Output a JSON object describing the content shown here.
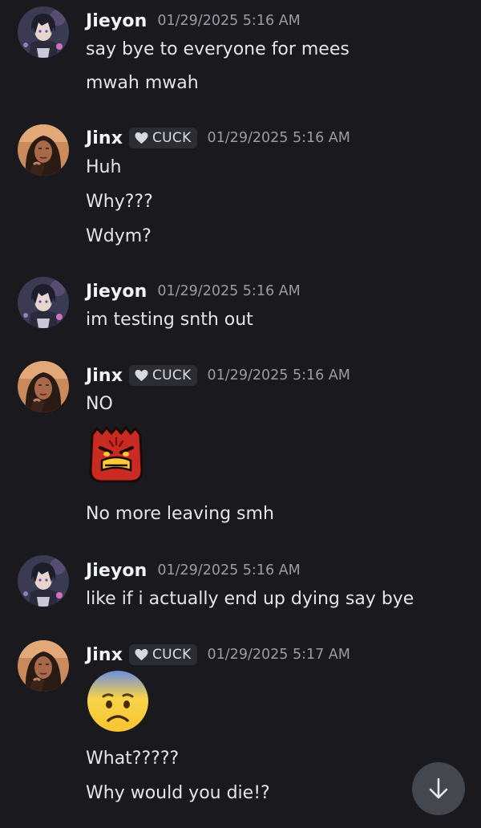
{
  "messages": [
    {
      "author": "Jieyon",
      "avatar_icon": "anime-avatar-icon",
      "timestamp": "01/29/2025 5:16 AM",
      "lines": [
        "say bye to everyone for mees",
        "mwah mwah"
      ]
    },
    {
      "author": "Jinx",
      "avatar_icon": "portrait-avatar-icon",
      "tag": "CUCK",
      "tag_icon": "heart-icon",
      "timestamp": "01/29/2025 5:16 AM",
      "lines": [
        "Huh",
        "Why???",
        "Wdym?"
      ]
    },
    {
      "author": "Jieyon",
      "avatar_icon": "anime-avatar-icon",
      "timestamp": "01/29/2025 5:16 AM",
      "lines": [
        "im testing snth out"
      ]
    },
    {
      "author": "Jinx",
      "avatar_icon": "portrait-avatar-icon",
      "tag": "CUCK",
      "tag_icon": "heart-icon",
      "timestamp": "01/29/2025 5:16 AM",
      "lines": [
        "NO",
        "No more leaving smh"
      ],
      "emoji": "angry-red-bag-emoji"
    },
    {
      "author": "Jieyon",
      "avatar_icon": "anime-avatar-icon",
      "timestamp": "01/29/2025 5:16 AM",
      "lines": [
        "like if i actually end up dying  say bye"
      ]
    },
    {
      "author": "Jinx",
      "avatar_icon": "portrait-avatar-icon",
      "tag": "CUCK",
      "tag_icon": "heart-icon",
      "timestamp": "01/29/2025 5:17 AM",
      "lines": [
        "What?????",
        "Why would you die!?"
      ],
      "emoji": "anxious-face-emoji"
    }
  ],
  "scroll_button_icon": "arrow-down-icon",
  "colors": {
    "background": "#1a1a1e",
    "username": "#f2f3f5",
    "timestamp": "#9a9ba3",
    "tag_background": "#2c2d33",
    "scroll_button": "#45474f"
  }
}
